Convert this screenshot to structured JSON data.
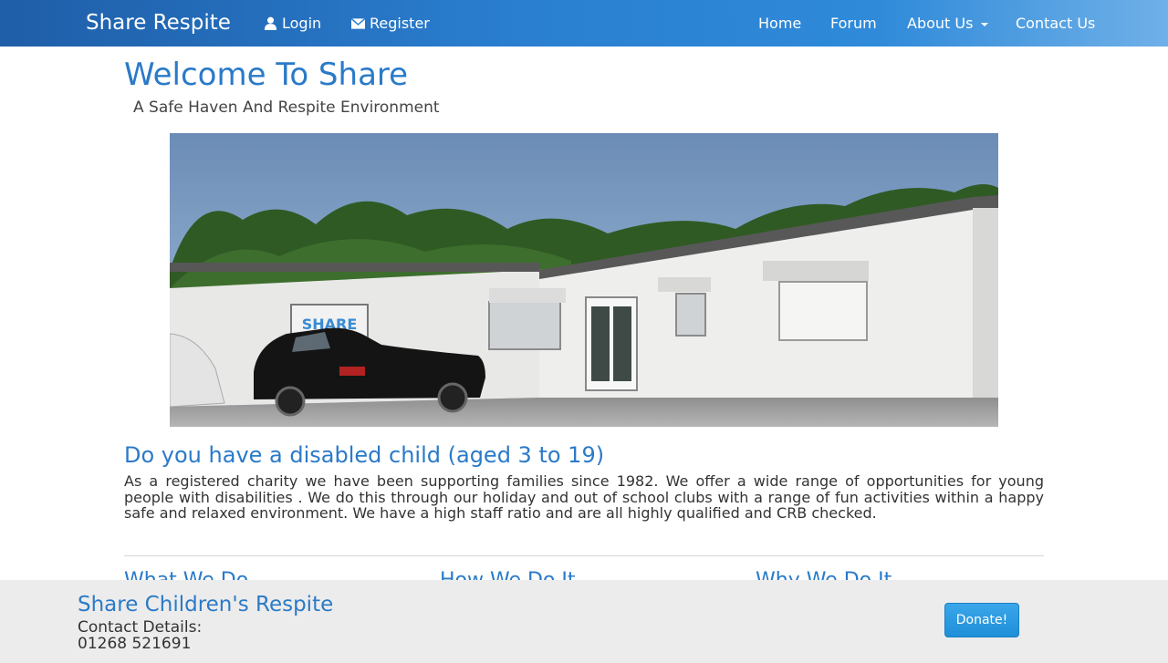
{
  "navbar": {
    "brand": "Share Respite",
    "login": "Login",
    "register": "Register",
    "links": {
      "home": "Home",
      "forum": "Forum",
      "about": "About Us",
      "contact": "Contact Us"
    }
  },
  "main": {
    "title": "Welcome To Share",
    "subtitle": "A Safe Haven And Respite Environment",
    "hero_sign_text": "SHARE",
    "heading": "Do you have a disabled child (aged 3 to 19)",
    "body": "As a registered charity we have been supporting families since 1982. We offer a wide range of opportunities for young people with disabilities . We do this through our holiday and out of school clubs with a range of fun activities within a happy safe and relaxed environment. We have a high staff ratio and are all highly qualified and CRB checked.",
    "columns": [
      "What We Do",
      "How We Do It",
      "Why We Do It"
    ]
  },
  "footer": {
    "title": "Share Children's Respite",
    "contact_label": "Contact Details:",
    "phone": "01268 521691",
    "donate": "Donate!"
  },
  "colors": {
    "accent": "#2a7ac8",
    "navbar_start": "#1f5ea8",
    "navbar_end": "#6fb0e8",
    "donate": "#2a9ae2",
    "footer_bg": "#ececec"
  }
}
